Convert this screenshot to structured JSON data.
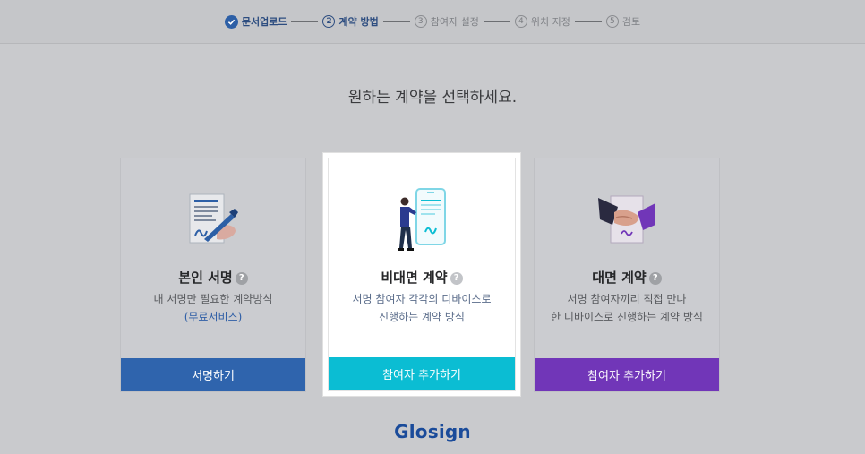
{
  "stepper": {
    "steps": [
      {
        "label": "문서업로드",
        "state": "done"
      },
      {
        "num": "2",
        "label": "계약 방법",
        "state": "current"
      },
      {
        "num": "3",
        "label": "참여자 설정",
        "state": "todo"
      },
      {
        "num": "4",
        "label": "위치 지정",
        "state": "todo"
      },
      {
        "num": "5",
        "label": "검토",
        "state": "todo"
      }
    ]
  },
  "main": {
    "title": "원하는 계약을 선택하세요."
  },
  "cards": [
    {
      "title": "본인 서명",
      "help": "?",
      "desc_line1": "내 서명만 필요한 계약방식",
      "desc_line2": "(무료서비스)",
      "button": "서명하기",
      "button_color": "#2f64ad",
      "icon": "document-pen-icon"
    },
    {
      "title": "비대면 계약",
      "help": "?",
      "desc_line1": "서명 참여자 각각의 디바이스로",
      "desc_line2": "진행하는 계약 방식",
      "button": "참여자 추가하기",
      "button_color": "#0bbdd3",
      "icon": "person-phone-icon"
    },
    {
      "title": "대면 계약",
      "help": "?",
      "desc_line1": "서명 참여자끼리 직접 만나",
      "desc_line2": "한 디바이스로 진행하는 계약 방식",
      "button": "참여자 추가하기",
      "button_color": "#7136b8",
      "icon": "handshake-icon"
    }
  ],
  "footer": {
    "logo": "Glosign",
    "logo_color": "#1a4b9a"
  }
}
